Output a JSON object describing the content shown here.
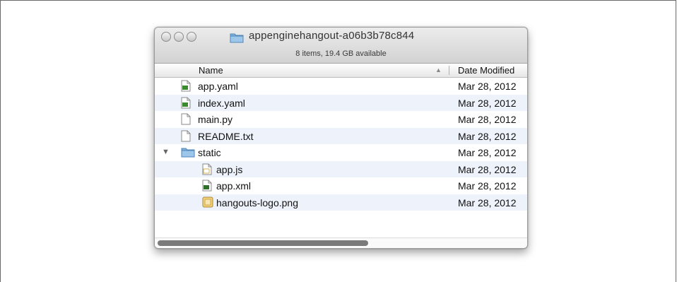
{
  "window": {
    "title": "appenginehangout-a06b3b78c844",
    "status": "8 items, 19.4 GB available"
  },
  "columns": {
    "name": "Name",
    "date": "Date Modified"
  },
  "files": [
    {
      "name": "app.yaml",
      "date": "Mar 28, 2012",
      "icon": "yaml-file-icon",
      "indent": 0
    },
    {
      "name": "index.yaml",
      "date": "Mar 28, 2012",
      "icon": "yaml-file-icon",
      "indent": 0
    },
    {
      "name": "main.py",
      "date": "Mar 28, 2012",
      "icon": "document-icon",
      "indent": 0
    },
    {
      "name": "README.txt",
      "date": "Mar 28, 2012",
      "icon": "document-icon",
      "indent": 0
    },
    {
      "name": "static",
      "date": "Mar 28, 2012",
      "icon": "folder-icon",
      "indent": 0,
      "expanded": true
    },
    {
      "name": "app.js",
      "date": "Mar 28, 2012",
      "icon": "js-file-icon",
      "indent": 1
    },
    {
      "name": "app.xml",
      "date": "Mar 28, 2012",
      "icon": "xml-file-icon",
      "indent": 1
    },
    {
      "name": "hangouts-logo.png",
      "date": "Mar 28, 2012",
      "icon": "image-file-icon",
      "indent": 1
    }
  ],
  "colors": {
    "row_alt": "#eef3fb",
    "folder": "#7fb2dc"
  }
}
